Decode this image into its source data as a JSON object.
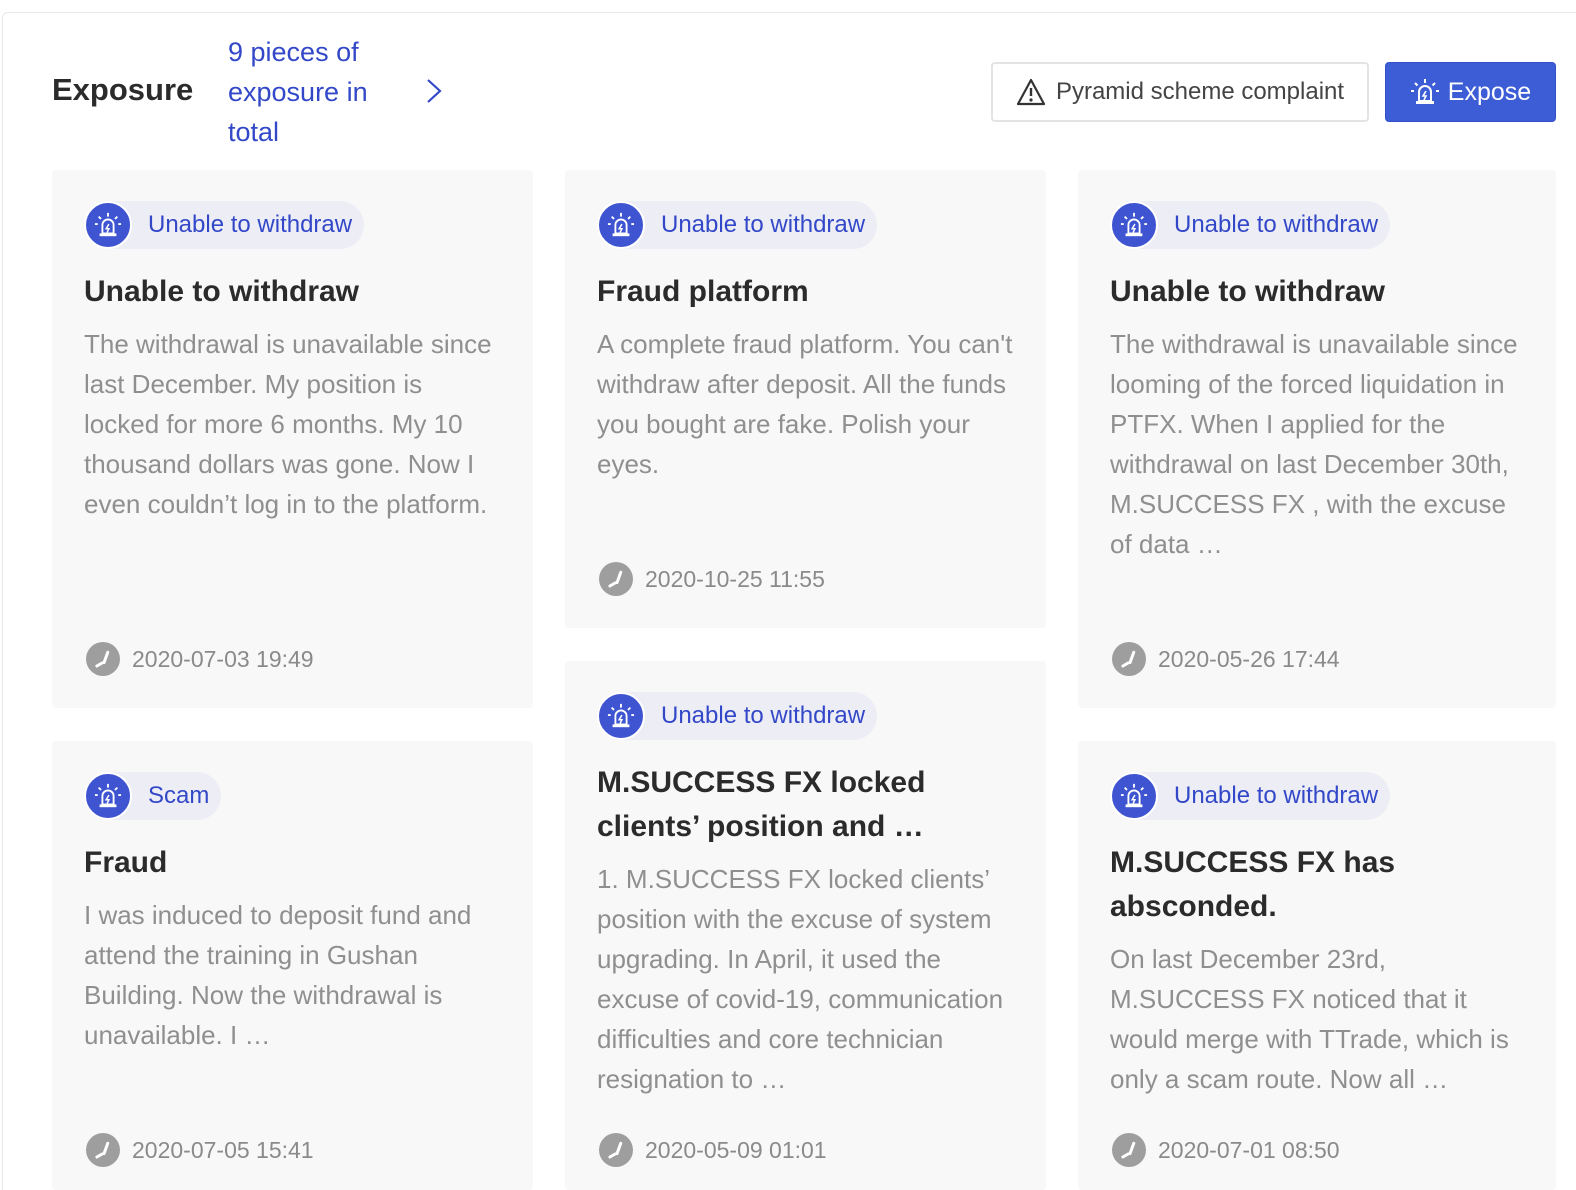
{
  "header": {
    "title": "Exposure",
    "total_link": "9 pieces of exposure in total",
    "complaint_button": "Pyramid scheme complaint",
    "expose_button": "Expose"
  },
  "colors": {
    "accent": "#3c5dd6",
    "tag_text": "#3348c8",
    "card_bg": "#f8f8f8"
  },
  "icons": {
    "tag": "alarm-siren-icon",
    "complaint": "warning-triangle-icon",
    "time": "clock-icon",
    "more": "chevron-right-icon"
  },
  "cards": [
    {
      "tag": "Unable to withdraw",
      "title": "Unable to withdraw",
      "body": "The withdrawal is unavailable since last December. My position is locked for more 6 months. My 10 thousand dollars was gone. Now I even couldn’t log in to the platform.",
      "time": "2020-07-03 19:49"
    },
    {
      "tag": "Unable to withdraw",
      "title": "Fraud platform",
      "body": "A complete fraud platform. You can't withdraw after deposit. All the funds you bought are fake. Polish your eyes.",
      "time": "2020-10-25 11:55"
    },
    {
      "tag": "Unable to withdraw",
      "title": "Unable to withdraw",
      "body": "The withdrawal is unavailable since looming of the forced liquidation in PTFX. When I applied for the withdrawal on last December 30th, M.SUCCESS FX , with the excuse of data …",
      "time": "2020-05-26 17:44"
    },
    {
      "tag": "Scam",
      "title": "Fraud",
      "body": "I was induced to deposit fund and attend the training in Gushan Building. Now the withdrawal is unavailable. I …",
      "time": "2020-07-05 15:41"
    },
    {
      "tag": "Unable to withdraw",
      "title": "M.SUCCESS FX locked clients’ position and …",
      "body": "1. M.SUCCESS FX locked clients’ position with the excuse of system upgrading. In April, it used the excuse of covid-19, communication difficulties and core technician resignation to …",
      "time": "2020-05-09 01:01"
    },
    {
      "tag": "Unable to withdraw",
      "title": "M.SUCCESS FX has absconded.",
      "body": "On last December 23rd, M.SUCCESS FX noticed that it would merge with TTrade, which is only a scam route. Now all …",
      "time": "2020-07-01 08:50"
    }
  ]
}
